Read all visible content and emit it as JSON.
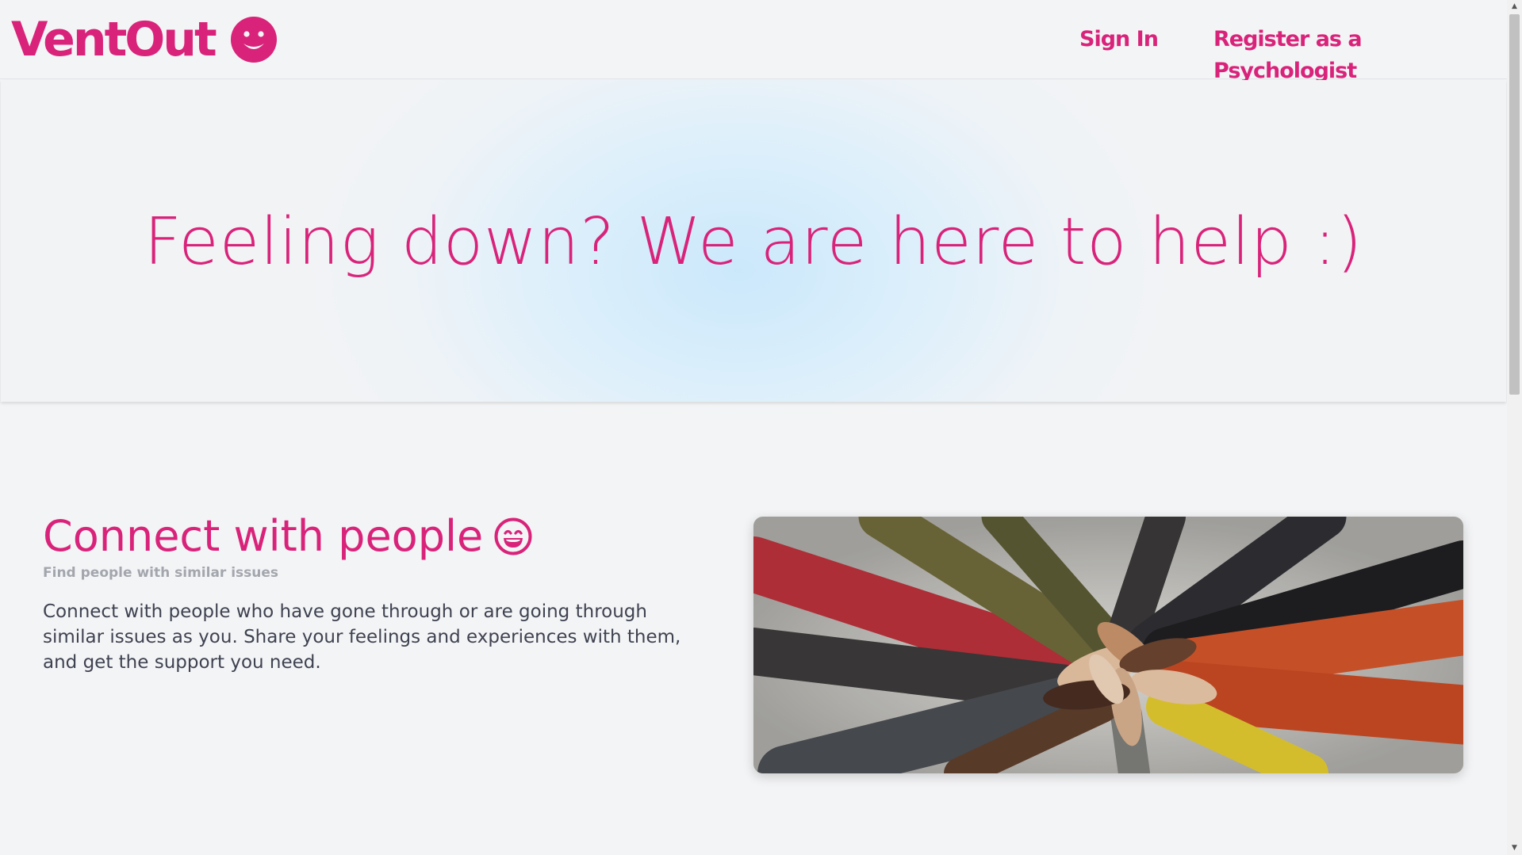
{
  "header": {
    "logo_text": "VentOut",
    "logo_icon": "smiley-icon",
    "nav": {
      "sign_in": "Sign In",
      "register": "Register as a Psychologist"
    }
  },
  "hero": {
    "title": "Feeling down? We are here to help :)"
  },
  "section": {
    "title": "Connect with people",
    "title_icon": "grinning-face-icon",
    "subtitle": "Find people with similar issues",
    "body": "Connect with people who have gone through or are going through similar issues as you. Share your feelings and experiences with them, and get the support you need.",
    "image_icon": "group-hands-photo"
  },
  "colors": {
    "brand": "#d9237a",
    "background": "#f3f4f6",
    "hero_glow": "#cbe8fb",
    "body_text": "#3f4250",
    "muted_text": "#a3a6ad"
  }
}
